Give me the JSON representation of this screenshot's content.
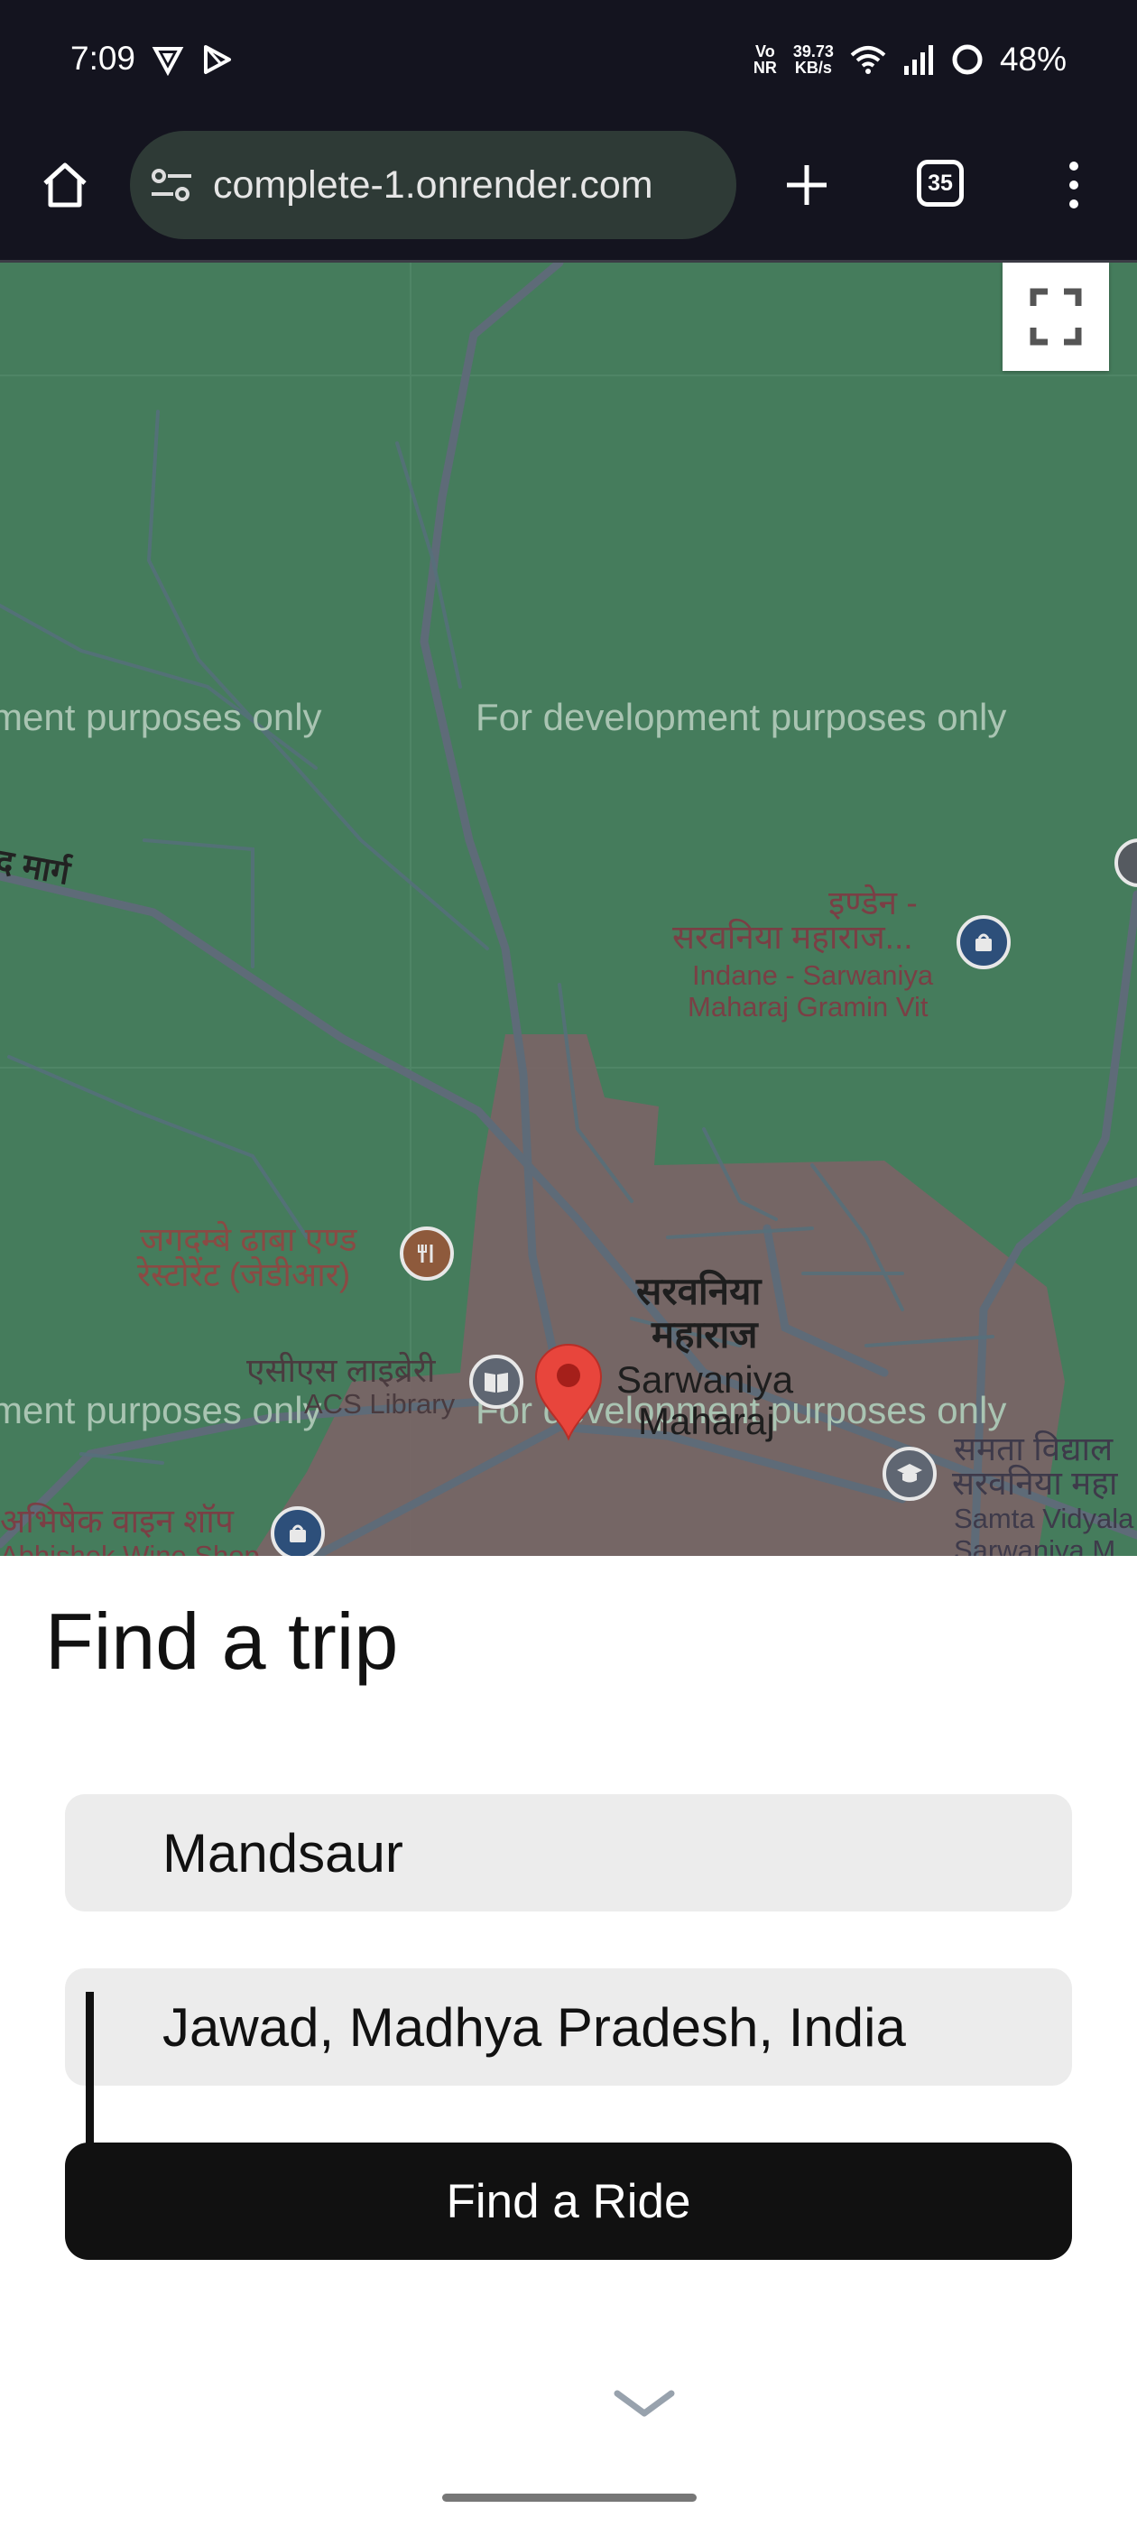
{
  "status_bar": {
    "time": "7:09",
    "network_label_top": "Vo",
    "network_label_bottom": "NR",
    "speed_top": "39.73",
    "speed_bottom": "KB/s",
    "battery": "48%"
  },
  "browser": {
    "url": "complete-1.onrender.com",
    "tab_count": "35"
  },
  "map": {
    "dev_watermark": "For development purposes only",
    "dev_watermark_cut": "ment purposes only",
    "road_label": "द मार्ग",
    "poi_indane_hi_1": "इण्डेन -",
    "poi_indane_hi_2": "सरवनिया महाराज...",
    "poi_indane_en_1": "Indane - Sarwaniya",
    "poi_indane_en_2": "Maharaj Gramin Vit",
    "poi_dhaba_1": "जगदम्बे ढाबा एण्ड",
    "poi_dhaba_2": "रेस्टोरेंट (जेडीआर)",
    "poi_library_hi": "एसीएस लाइब्रेरी",
    "poi_library_en": "ACS Library",
    "town_hi_1": "सरवनिया",
    "town_hi_2": "महाराज",
    "town_en_1": "Sarwaniya",
    "town_en_2": "Maharaj",
    "poi_wine_hi": "अभिषेक वाइन शॉप",
    "poi_wine_en": "Abhishek Wine Shop",
    "poi_school_hi_1": "समता विद्याल",
    "poi_school_hi_2": "सरवनिया महा",
    "poi_school_en_1": "Samta Vidyala",
    "poi_school_en_2": "Sarwaniya M"
  },
  "trip": {
    "title": "Find a trip",
    "origin": "Mandsaur",
    "destination": "Jawad, Madhya Pradesh, India",
    "button": "Find a Ride"
  },
  "colors": {
    "map_green": "#457c5c",
    "town_area": "#7a6466",
    "pin_red": "#e8453c"
  }
}
